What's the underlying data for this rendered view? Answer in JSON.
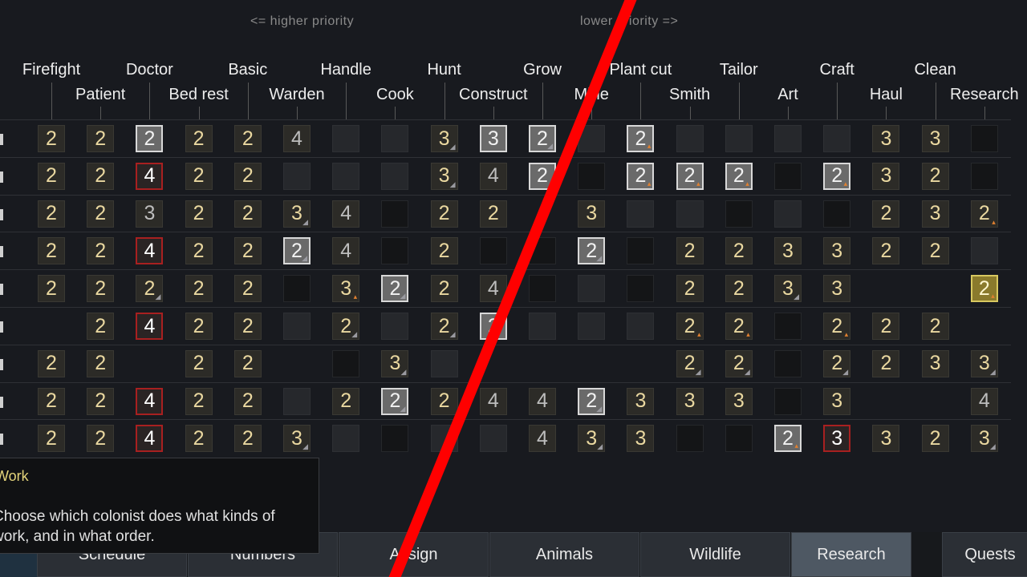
{
  "priority_hints": {
    "higher": "<= higher priority",
    "lower": "lower priority =>"
  },
  "columns": [
    {
      "label": "Firefight"
    },
    {
      "label": "Patient"
    },
    {
      "label": "Doctor"
    },
    {
      "label": "Bed rest"
    },
    {
      "label": "Basic"
    },
    {
      "label": "Warden"
    },
    {
      "label": "Handle"
    },
    {
      "label": "Cook"
    },
    {
      "label": "Hunt"
    },
    {
      "label": "Construct"
    },
    {
      "label": "Grow"
    },
    {
      "label": "Mine"
    },
    {
      "label": "Plant cut"
    },
    {
      "label": "Smith"
    },
    {
      "label": "Tailor"
    },
    {
      "label": "Art"
    },
    {
      "label": "Craft"
    },
    {
      "label": "Haul"
    },
    {
      "label": "Clean"
    },
    {
      "label": "Research"
    }
  ],
  "rows": [
    [
      "2",
      "2",
      "h:2",
      "2",
      "2",
      "g:4",
      "k",
      "k",
      "3:g",
      "h:3",
      "h:2:g",
      "k",
      "h:2:o",
      "k",
      "k",
      "k",
      "k",
      "3",
      "3",
      "b"
    ],
    [
      "2",
      "2",
      "r:4",
      "2",
      "2",
      "k",
      "k",
      "k",
      "3:g",
      "g:4",
      "h:2",
      "b",
      "h:2:o",
      "h:2:o",
      "h:2:o",
      "b",
      "h:2:o",
      "3",
      "2",
      "b"
    ],
    [
      "2",
      "2",
      "g:3",
      "2",
      "2",
      "3:g",
      "g:4",
      "b",
      "2",
      "2",
      "",
      "3",
      "k",
      "k",
      "b",
      "k",
      "b",
      "2",
      "3",
      "2:o"
    ],
    [
      "2",
      "2",
      "r:4",
      "2",
      "2",
      "h:2:g",
      "g:4",
      "b",
      "2",
      "b",
      "b",
      "h:2:g",
      "b",
      "2",
      "2",
      "3",
      "3",
      "2",
      "2",
      "k"
    ],
    [
      "2",
      "2",
      "2:g",
      "2",
      "2",
      "b",
      "3:o",
      "h:2:g",
      "2",
      "g:4",
      "b",
      "k",
      "b",
      "2",
      "2",
      "3:g",
      "3",
      "",
      "",
      "y:2:o"
    ],
    [
      "",
      "2",
      "r:4",
      "2",
      "2",
      "k",
      "2:g",
      "k",
      "2:g",
      "h:2",
      "k",
      "k",
      "k",
      "2:o",
      "2:o",
      "b",
      "2:o",
      "2",
      "2",
      ""
    ],
    [
      "2",
      "2",
      "",
      "2",
      "2",
      "",
      "b",
      "3:g",
      "k",
      "",
      "",
      "",
      "",
      "2:g",
      "2:g",
      "b",
      "2:g",
      "2",
      "3",
      "3:g"
    ],
    [
      "2",
      "2",
      "r:4",
      "2",
      "2",
      "k",
      "2",
      "h:2:g",
      "2",
      "g:4",
      "g:4",
      "h:2:g",
      "3",
      "3",
      "3",
      "b",
      "3",
      "",
      "",
      "g:4"
    ],
    [
      "2",
      "2",
      "r:4",
      "2",
      "2",
      "3:g",
      "k",
      "b",
      "k",
      "k",
      "g:4",
      "3:g",
      "3",
      "b",
      "b",
      "h:2:o",
      "r:3",
      "3",
      "2",
      "3:g"
    ]
  ],
  "tooltip": {
    "title": "Work",
    "body": "Choose which colonist does what kinds of work, and in what order."
  },
  "tabs": [
    {
      "label": "Schedule",
      "active": false
    },
    {
      "label": "Numbers",
      "active": false
    },
    {
      "label": "Assign",
      "active": false
    },
    {
      "label": "Animals",
      "active": false
    },
    {
      "label": "Wildlife",
      "active": false
    },
    {
      "label": "Research",
      "active": true
    },
    {
      "label": "Quests",
      "active": false
    }
  ],
  "colors": {
    "accent_yellow": "#e3d37a",
    "priority_gold": "#ead8a0",
    "overlay_red": "#ff0000",
    "active_tab": "#4e5863"
  }
}
